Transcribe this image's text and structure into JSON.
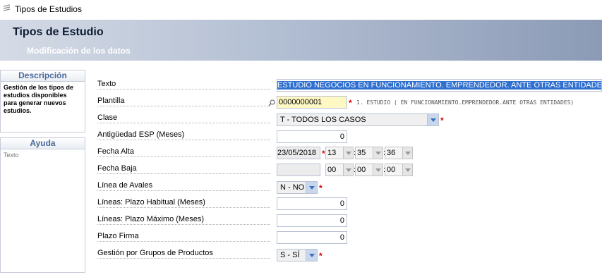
{
  "window": {
    "title": "Tipos de Estudios"
  },
  "banner": {
    "title": "Tipos de Estudio",
    "subtitle": "Modificación de los datos"
  },
  "description_panel": {
    "header": "Descripción",
    "body": "Gestión de los tipos de estudios disponibles para generar nuevos estudios."
  },
  "help_panel": {
    "header": "Ayuda",
    "body": "Texto"
  },
  "form": {
    "texto": {
      "label": "Texto",
      "value": "ESTUDIO NEGOCIOS EN FUNCIONAMIENTO. EMPRENDEDOR. ANTE OTRAS ENTIDADES"
    },
    "plantilla": {
      "label": "Plantilla",
      "value": "0000000001",
      "hint": "1. ESTUDIO ( EN FUNCIONAMIENTO.EMPRENDEDOR.ANTE OTRAS ENTIDADES)"
    },
    "clase": {
      "label": "Clase",
      "value": "T - TODOS LOS CASOS"
    },
    "antiguedad": {
      "label": "Antigüedad ESP (Meses)",
      "value": "0"
    },
    "fecha_alta": {
      "label": "Fecha Alta",
      "date": "23/05/2018",
      "hour": "13",
      "minute": "35",
      "second": "36"
    },
    "fecha_baja": {
      "label": "Fecha Baja",
      "date": "",
      "hour": "00",
      "minute": "00",
      "second": "00"
    },
    "linea_avales": {
      "label": "Línea de Avales",
      "value": "N - NO"
    },
    "plazo_habitual": {
      "label": "Líneas: Plazo Habitual (Meses)",
      "value": "0"
    },
    "plazo_maximo": {
      "label": "Líneas: Plazo Máximo (Meses)",
      "value": "0"
    },
    "plazo_firma": {
      "label": "Plazo Firma",
      "value": "0"
    },
    "gestion_grupos": {
      "label": "Gestión por Grupos de Productos",
      "value": "S - SÍ"
    },
    "required_marker": "*",
    "time_separator": ":"
  },
  "colors": {
    "accent": "#2f6fd0",
    "required": "#d40000",
    "panel_header": "#4a6a99"
  }
}
